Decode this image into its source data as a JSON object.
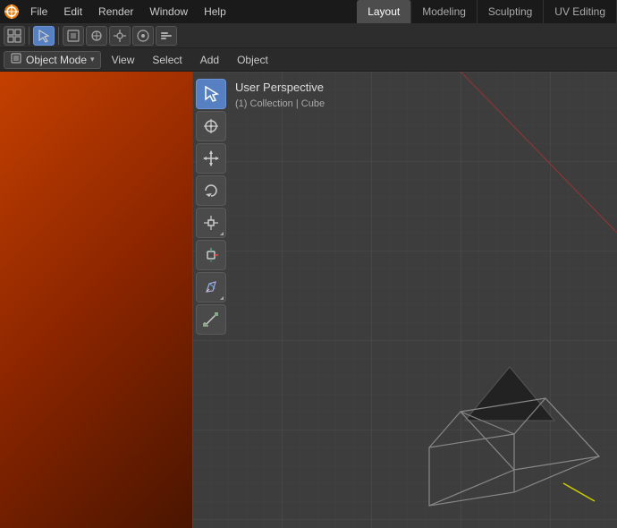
{
  "app": {
    "logo": "🔶"
  },
  "menu_bar": {
    "items": [
      "File",
      "Edit",
      "Render",
      "Window",
      "Help"
    ]
  },
  "workspace_tabs": [
    {
      "label": "Layout",
      "active": true
    },
    {
      "label": "Modeling",
      "active": false
    },
    {
      "label": "Sculpting",
      "active": false
    },
    {
      "label": "UV Editing",
      "active": false
    }
  ],
  "toolbar_row": {
    "editor_icon": "⊞",
    "transform_orientation": "◎",
    "snap_icons": [
      "□",
      "□",
      "□",
      "□",
      "□"
    ]
  },
  "header_row": {
    "object_mode_label": "Object Mode",
    "view_label": "View",
    "select_label": "Select",
    "add_label": "Add",
    "object_label": "Object"
  },
  "viewport": {
    "perspective_label": "User Perspective",
    "collection_label": "(1) Collection | Cube"
  },
  "left_toolbar": {
    "tools": [
      {
        "name": "select",
        "icon": "↖",
        "active": true
      },
      {
        "name": "cursor",
        "icon": "⊕",
        "active": false
      },
      {
        "name": "move",
        "icon": "✛",
        "active": false
      },
      {
        "name": "rotate",
        "icon": "↻",
        "active": false
      },
      {
        "name": "scale",
        "icon": "⤡",
        "active": false
      },
      {
        "name": "transform",
        "icon": "⊹",
        "active": false
      },
      {
        "name": "annotate",
        "icon": "✏",
        "active": false
      },
      {
        "name": "measure",
        "icon": "⊾",
        "active": false
      }
    ]
  }
}
